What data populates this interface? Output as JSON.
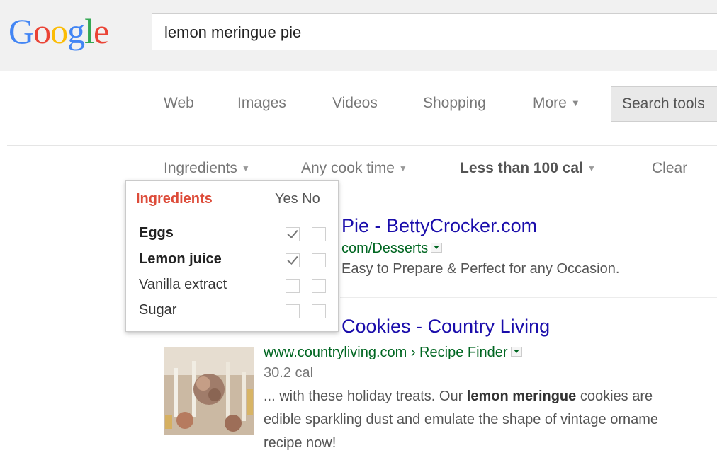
{
  "header": {
    "logo_letters": [
      {
        "ch": "G",
        "color": "#4285f4"
      },
      {
        "ch": "o",
        "color": "#ea4335"
      },
      {
        "ch": "o",
        "color": "#fbbc05"
      },
      {
        "ch": "g",
        "color": "#4285f4"
      },
      {
        "ch": "l",
        "color": "#34a853"
      },
      {
        "ch": "e",
        "color": "#ea4335"
      }
    ],
    "search_value": "lemon meringue pie"
  },
  "tabs": {
    "web": "Web",
    "images": "Images",
    "videos": "Videos",
    "shopping": "Shopping",
    "more": "More",
    "search_tools": "Search tools"
  },
  "filters": {
    "ingredients": "Ingredients",
    "cook_time": "Any cook time",
    "calories": "Less than 100 cal",
    "clear": "Clear"
  },
  "popup": {
    "title": "Ingredients",
    "yes_no": "Yes No",
    "items": [
      {
        "label": "Eggs",
        "bold": true,
        "yes": true,
        "no": false
      },
      {
        "label": "Lemon juice",
        "bold": true,
        "yes": true,
        "no": false
      },
      {
        "label": "Vanilla extract",
        "bold": false,
        "yes": false,
        "no": false
      },
      {
        "label": "Sugar",
        "bold": false,
        "yes": false,
        "no": false
      }
    ]
  },
  "results": {
    "r1": {
      "title": "Pie - BettyCrocker.com",
      "url": "com/Desserts",
      "snippet": "Easy to Prepare & Perfect for any Occasion."
    },
    "r2": {
      "title": "Cookies - Country Living",
      "url": "www.countryliving.com › Recipe Finder",
      "meta": "30.2 cal",
      "snippet_line1_pre": "... with these holiday treats. Our ",
      "snippet_line1_bold": "lemon meringue",
      "snippet_line1_post": " cookies are",
      "snippet_line2": "edible sparkling dust and emulate the shape of vintage orname",
      "snippet_line3": "recipe now!"
    }
  },
  "colors": {
    "link": "#1a0dab",
    "url": "#006621",
    "accent": "#dd4b39"
  }
}
